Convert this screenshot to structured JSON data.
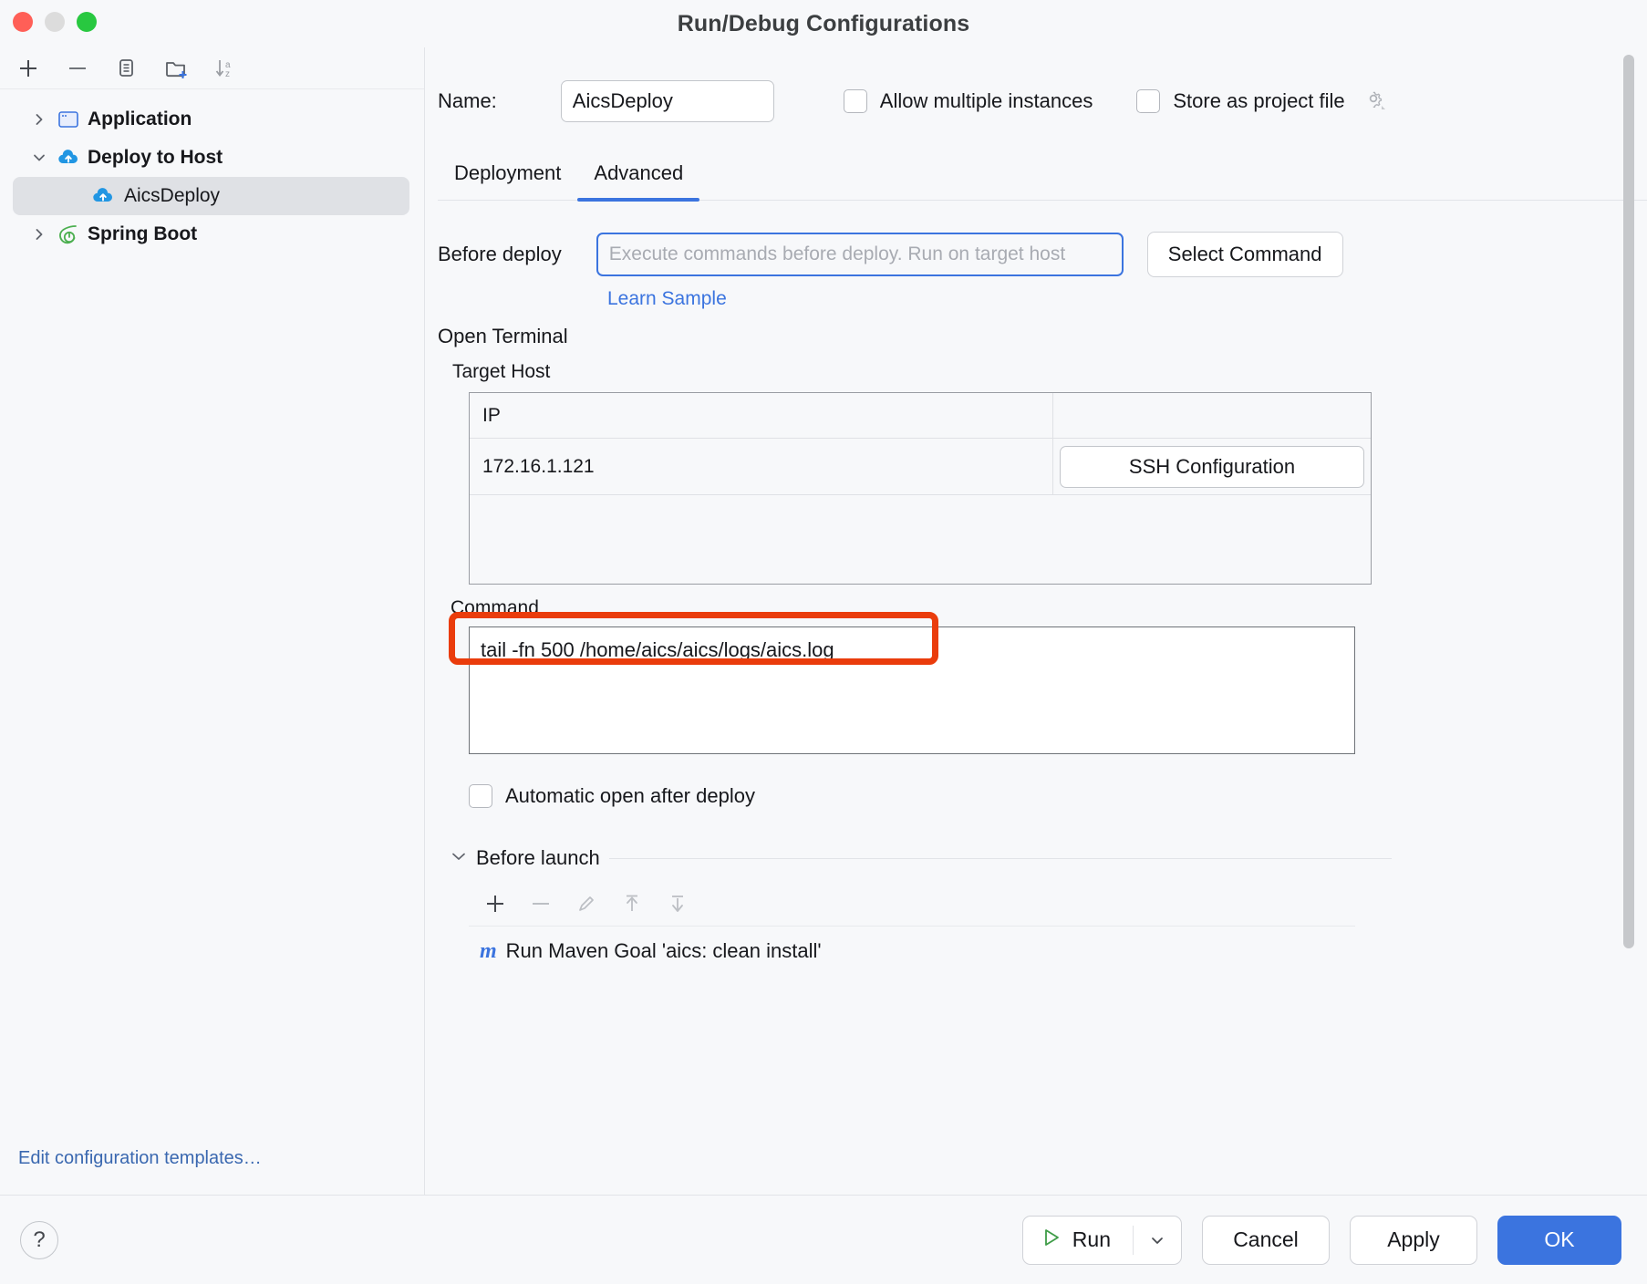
{
  "window": {
    "title": "Run/Debug Configurations",
    "traffic_lights": [
      "close",
      "minimize",
      "zoom"
    ]
  },
  "sidebar": {
    "toolbar": [
      {
        "name": "add-configuration",
        "glyph": "+"
      },
      {
        "name": "remove-configuration",
        "glyph": "−"
      },
      {
        "name": "copy-configuration",
        "glyph": "copy"
      },
      {
        "name": "new-folder",
        "glyph": "folder-plus"
      },
      {
        "name": "sort-alphabetically",
        "glyph": "sort-az"
      }
    ],
    "tree": [
      {
        "label": "Application",
        "type": "group",
        "expanded": false,
        "icon": "application-icon"
      },
      {
        "label": "Deploy to Host",
        "type": "group",
        "expanded": true,
        "icon": "cloud-upload-icon"
      },
      {
        "label": "AicsDeploy",
        "type": "child",
        "selected": true,
        "icon": "cloud-upload-icon"
      },
      {
        "label": "Spring Boot",
        "type": "group",
        "expanded": false,
        "icon": "spring-boot-icon"
      }
    ],
    "edit_templates_link": "Edit configuration templates…"
  },
  "main": {
    "name_label": "Name:",
    "name_value": "AicsDeploy",
    "allow_multiple_instances_label": "Allow multiple instances",
    "allow_multiple_instances_checked": false,
    "store_as_project_file_label": "Store as project file",
    "store_as_project_file_checked": false,
    "tabs": [
      {
        "label": "Deployment",
        "active": false
      },
      {
        "label": "Advanced",
        "active": true
      }
    ],
    "before_deploy": {
      "label": "Before deploy",
      "value": "",
      "placeholder": "Execute commands before deploy. Run on target host",
      "select_command_label": "Select Command",
      "learn_sample_label": "Learn Sample"
    },
    "open_terminal": {
      "section_label": "Open Terminal",
      "target_host_label": "Target Host",
      "table": {
        "columns": [
          "IP",
          ""
        ],
        "rows": [
          {
            "ip": "172.16.1.121",
            "action_label": "SSH Configuration"
          }
        ]
      },
      "command_label": "Command",
      "command_value": "tail -fn 500 /home/aics/aics/logs/aics.log",
      "automatic_open_label": "Automatic open after deploy",
      "automatic_open_checked": false
    },
    "before_launch": {
      "title": "Before launch",
      "expanded": true,
      "toolbar": [
        {
          "name": "add-task",
          "glyph": "+",
          "enabled": true
        },
        {
          "name": "remove-task",
          "glyph": "−",
          "enabled": false
        },
        {
          "name": "edit-task",
          "glyph": "pencil",
          "enabled": false
        },
        {
          "name": "move-up-task",
          "glyph": "arrow-up",
          "enabled": false
        },
        {
          "name": "move-down-task",
          "glyph": "arrow-down",
          "enabled": false
        }
      ],
      "items": [
        {
          "icon": "maven-icon",
          "icon_glyph": "m",
          "label": "Run Maven Goal 'aics: clean install'"
        }
      ]
    }
  },
  "footer": {
    "help_glyph": "?",
    "run_label": "Run",
    "run_dropdown_glyph": "⌄",
    "cancel_label": "Cancel",
    "apply_label": "Apply",
    "ok_label": "OK"
  },
  "colors": {
    "accent_blue": "#3b74df",
    "link_blue": "#3a68b0",
    "highlight_red": "#ea3c0c",
    "background": "#f7f8fa",
    "traffic_red": "#ff5f57",
    "traffic_yellow": "#dcdcdc",
    "traffic_green": "#28c840"
  }
}
